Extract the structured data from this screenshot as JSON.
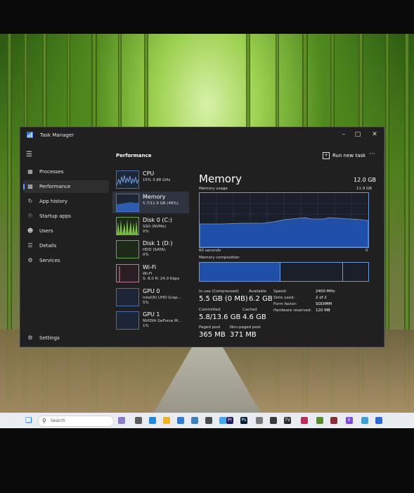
{
  "window": {
    "title": "Task Manager"
  },
  "sidebar": {
    "items": [
      {
        "label": "Processes",
        "icon": "processes-icon"
      },
      {
        "label": "Performance",
        "icon": "performance-icon"
      },
      {
        "label": "App history",
        "icon": "history-icon"
      },
      {
        "label": "Startup apps",
        "icon": "startup-icon"
      },
      {
        "label": "Users",
        "icon": "users-icon"
      },
      {
        "label": "Details",
        "icon": "details-icon"
      },
      {
        "label": "Services",
        "icon": "services-icon"
      }
    ],
    "settings_label": "Settings"
  },
  "header": {
    "title": "Performance",
    "run_task_label": "Run new task"
  },
  "resources": [
    {
      "name": "CPU",
      "sub": "15% 3.88 GHz"
    },
    {
      "name": "Memory",
      "sub": "5.7/11.9 GB (48%)"
    },
    {
      "name": "Disk 0 (C:)",
      "sub": "SSD (NVMe)",
      "sub2": "0%"
    },
    {
      "name": "Disk 1 (D:)",
      "sub": "HDD (SATA)",
      "sub2": "0%"
    },
    {
      "name": "Wi-Fi",
      "sub": "Wi-Fi",
      "sub2": "S: 8.0 R: 24.0 Kbps"
    },
    {
      "name": "GPU 0",
      "sub": "Intel(R) UHD Grap...",
      "sub2": "5%"
    },
    {
      "name": "GPU 1",
      "sub": "NVIDIA GeForce M...",
      "sub2": "1%"
    }
  ],
  "detail": {
    "title": "Memory",
    "total": "12.0 GB",
    "usage_label": "Memory usage",
    "usage_max": "11.9 GB",
    "axis_left": "60 seconds",
    "axis_right": "0",
    "composition_label": "Memory composition",
    "usage_fraction": 0.48,
    "stats": {
      "in_use_label": "In use (Compressed)",
      "in_use": "5.5 GB (0 MB)",
      "available_label": "Available",
      "available": "6.2 GB",
      "committed_label": "Committed",
      "committed": "5.8/13.6 GB",
      "cached_label": "Cached",
      "cached": "4.6 GB",
      "paged_label": "Paged pool",
      "paged": "365 MB",
      "nonpaged_label": "Non-paged pool",
      "nonpaged": "371 MB"
    },
    "specs": [
      {
        "label": "Speed:",
        "value": "2400 MHz"
      },
      {
        "label": "Slots used:",
        "value": "2 of 2"
      },
      {
        "label": "Form factor:",
        "value": "SODIMM"
      },
      {
        "label": "Hardware reserved:",
        "value": "120 MB"
      }
    ]
  },
  "taskbar": {
    "search_placeholder": "Search"
  },
  "colors": {
    "accent": "#5aa7ff",
    "memory_fill": "#1f4fa8",
    "window_bg": "#202020"
  }
}
